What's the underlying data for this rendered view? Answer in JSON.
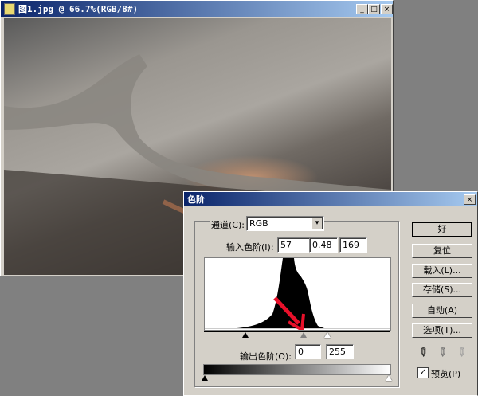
{
  "document_window": {
    "title": "图1.jpg @ 66.7%(RGB/8#)",
    "minimize": "_",
    "maximize": "□",
    "close": "×"
  },
  "levels_dialog": {
    "title": "色阶",
    "close": "×",
    "channel_label": "通道(C):",
    "channel_value": "RGB",
    "input_levels_label": "输入色阶(I):",
    "input_black": "57",
    "input_gamma": "0.48",
    "input_white": "169",
    "output_levels_label": "输出色阶(O):",
    "output_black": "0",
    "output_white": "255",
    "buttons": [
      "好",
      "复位",
      "载入(L)...",
      "存储(S)...",
      "自动(A)",
      "选项(T)..."
    ],
    "preview_label": "预览(P)",
    "preview_checked": true,
    "arrow_color": "#e8102a"
  }
}
